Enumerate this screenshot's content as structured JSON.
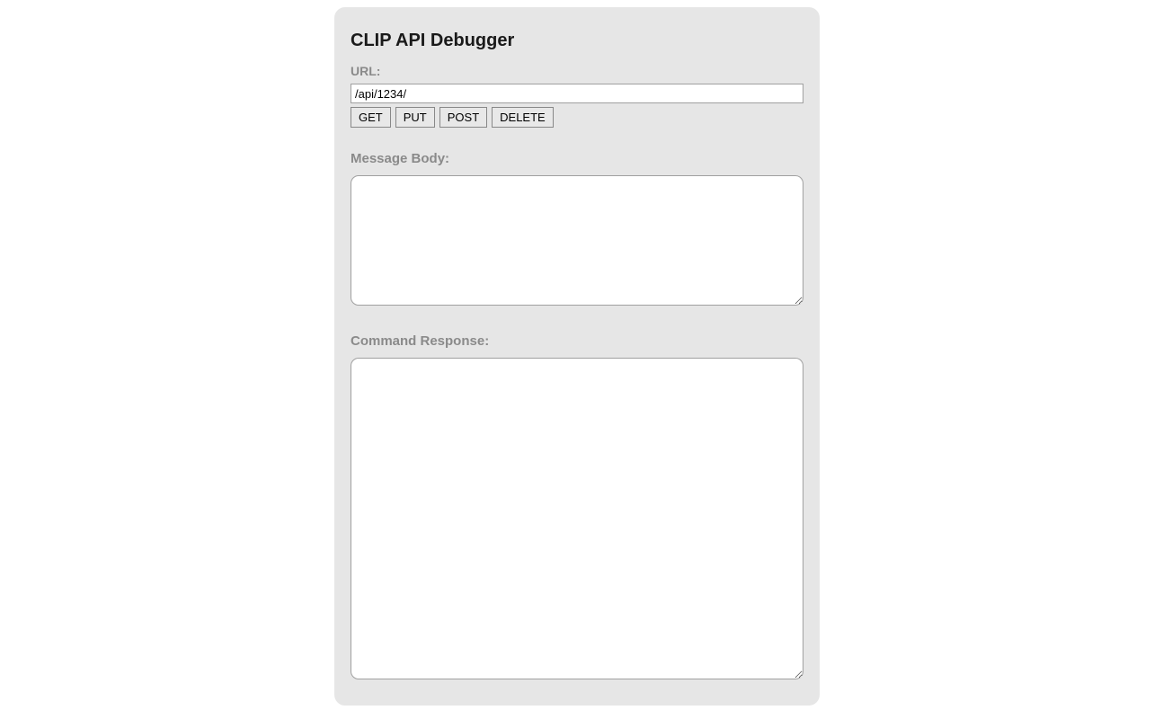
{
  "title": "CLIP API Debugger",
  "url": {
    "label": "URL:",
    "value": "/api/1234/"
  },
  "buttons": {
    "get": "GET",
    "put": "PUT",
    "post": "POST",
    "delete": "DELETE"
  },
  "messageBody": {
    "label": "Message Body:",
    "value": ""
  },
  "commandResponse": {
    "label": "Command Response:",
    "value": ""
  }
}
